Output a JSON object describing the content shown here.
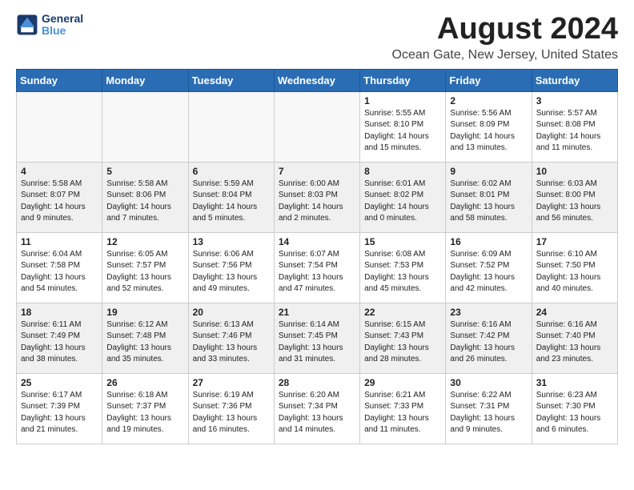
{
  "logo": {
    "line1": "General",
    "line2": "Blue"
  },
  "title": "August 2024",
  "location": "Ocean Gate, New Jersey, United States",
  "days_of_week": [
    "Sunday",
    "Monday",
    "Tuesday",
    "Wednesday",
    "Thursday",
    "Friday",
    "Saturday"
  ],
  "weeks": [
    [
      {
        "day": "",
        "info": ""
      },
      {
        "day": "",
        "info": ""
      },
      {
        "day": "",
        "info": ""
      },
      {
        "day": "",
        "info": ""
      },
      {
        "day": "1",
        "info": "Sunrise: 5:55 AM\nSunset: 8:10 PM\nDaylight: 14 hours\nand 15 minutes."
      },
      {
        "day": "2",
        "info": "Sunrise: 5:56 AM\nSunset: 8:09 PM\nDaylight: 14 hours\nand 13 minutes."
      },
      {
        "day": "3",
        "info": "Sunrise: 5:57 AM\nSunset: 8:08 PM\nDaylight: 14 hours\nand 11 minutes."
      }
    ],
    [
      {
        "day": "4",
        "info": "Sunrise: 5:58 AM\nSunset: 8:07 PM\nDaylight: 14 hours\nand 9 minutes."
      },
      {
        "day": "5",
        "info": "Sunrise: 5:58 AM\nSunset: 8:06 PM\nDaylight: 14 hours\nand 7 minutes."
      },
      {
        "day": "6",
        "info": "Sunrise: 5:59 AM\nSunset: 8:04 PM\nDaylight: 14 hours\nand 5 minutes."
      },
      {
        "day": "7",
        "info": "Sunrise: 6:00 AM\nSunset: 8:03 PM\nDaylight: 14 hours\nand 2 minutes."
      },
      {
        "day": "8",
        "info": "Sunrise: 6:01 AM\nSunset: 8:02 PM\nDaylight: 14 hours\nand 0 minutes."
      },
      {
        "day": "9",
        "info": "Sunrise: 6:02 AM\nSunset: 8:01 PM\nDaylight: 13 hours\nand 58 minutes."
      },
      {
        "day": "10",
        "info": "Sunrise: 6:03 AM\nSunset: 8:00 PM\nDaylight: 13 hours\nand 56 minutes."
      }
    ],
    [
      {
        "day": "11",
        "info": "Sunrise: 6:04 AM\nSunset: 7:58 PM\nDaylight: 13 hours\nand 54 minutes."
      },
      {
        "day": "12",
        "info": "Sunrise: 6:05 AM\nSunset: 7:57 PM\nDaylight: 13 hours\nand 52 minutes."
      },
      {
        "day": "13",
        "info": "Sunrise: 6:06 AM\nSunset: 7:56 PM\nDaylight: 13 hours\nand 49 minutes."
      },
      {
        "day": "14",
        "info": "Sunrise: 6:07 AM\nSunset: 7:54 PM\nDaylight: 13 hours\nand 47 minutes."
      },
      {
        "day": "15",
        "info": "Sunrise: 6:08 AM\nSunset: 7:53 PM\nDaylight: 13 hours\nand 45 minutes."
      },
      {
        "day": "16",
        "info": "Sunrise: 6:09 AM\nSunset: 7:52 PM\nDaylight: 13 hours\nand 42 minutes."
      },
      {
        "day": "17",
        "info": "Sunrise: 6:10 AM\nSunset: 7:50 PM\nDaylight: 13 hours\nand 40 minutes."
      }
    ],
    [
      {
        "day": "18",
        "info": "Sunrise: 6:11 AM\nSunset: 7:49 PM\nDaylight: 13 hours\nand 38 minutes."
      },
      {
        "day": "19",
        "info": "Sunrise: 6:12 AM\nSunset: 7:48 PM\nDaylight: 13 hours\nand 35 minutes."
      },
      {
        "day": "20",
        "info": "Sunrise: 6:13 AM\nSunset: 7:46 PM\nDaylight: 13 hours\nand 33 minutes."
      },
      {
        "day": "21",
        "info": "Sunrise: 6:14 AM\nSunset: 7:45 PM\nDaylight: 13 hours\nand 31 minutes."
      },
      {
        "day": "22",
        "info": "Sunrise: 6:15 AM\nSunset: 7:43 PM\nDaylight: 13 hours\nand 28 minutes."
      },
      {
        "day": "23",
        "info": "Sunrise: 6:16 AM\nSunset: 7:42 PM\nDaylight: 13 hours\nand 26 minutes."
      },
      {
        "day": "24",
        "info": "Sunrise: 6:16 AM\nSunset: 7:40 PM\nDaylight: 13 hours\nand 23 minutes."
      }
    ],
    [
      {
        "day": "25",
        "info": "Sunrise: 6:17 AM\nSunset: 7:39 PM\nDaylight: 13 hours\nand 21 minutes."
      },
      {
        "day": "26",
        "info": "Sunrise: 6:18 AM\nSunset: 7:37 PM\nDaylight: 13 hours\nand 19 minutes."
      },
      {
        "day": "27",
        "info": "Sunrise: 6:19 AM\nSunset: 7:36 PM\nDaylight: 13 hours\nand 16 minutes."
      },
      {
        "day": "28",
        "info": "Sunrise: 6:20 AM\nSunset: 7:34 PM\nDaylight: 13 hours\nand 14 minutes."
      },
      {
        "day": "29",
        "info": "Sunrise: 6:21 AM\nSunset: 7:33 PM\nDaylight: 13 hours\nand 11 minutes."
      },
      {
        "day": "30",
        "info": "Sunrise: 6:22 AM\nSunset: 7:31 PM\nDaylight: 13 hours\nand 9 minutes."
      },
      {
        "day": "31",
        "info": "Sunrise: 6:23 AM\nSunset: 7:30 PM\nDaylight: 13 hours\nand 6 minutes."
      }
    ]
  ]
}
